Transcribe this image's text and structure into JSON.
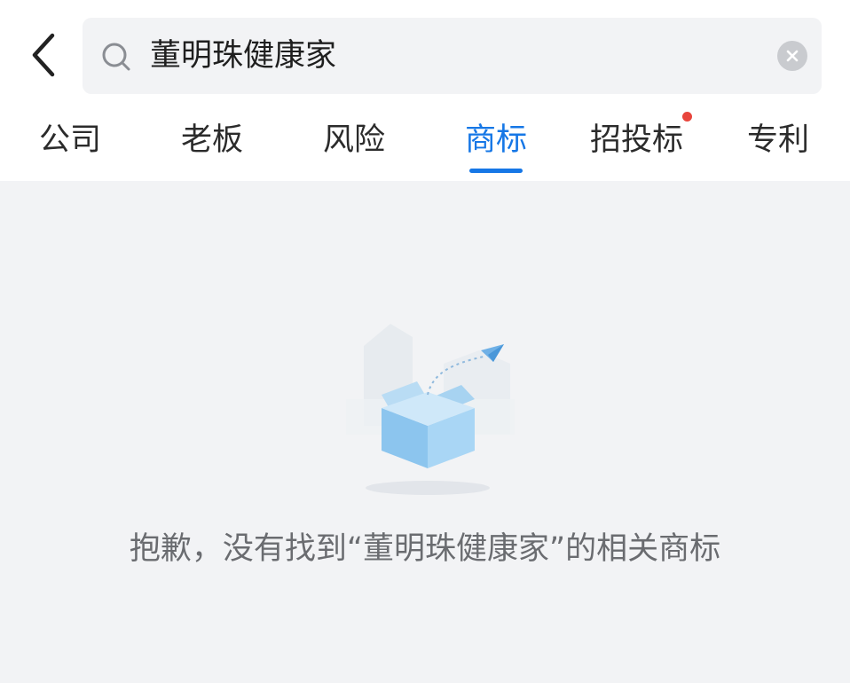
{
  "search": {
    "query": "董明珠健康家"
  },
  "tabs": [
    {
      "label": "公司",
      "active": false,
      "badge": false
    },
    {
      "label": "老板",
      "active": false,
      "badge": false
    },
    {
      "label": "风险",
      "active": false,
      "badge": false
    },
    {
      "label": "商标",
      "active": true,
      "badge": false
    },
    {
      "label": "招投标",
      "active": false,
      "badge": true
    },
    {
      "label": "专利",
      "active": false,
      "badge": false
    }
  ],
  "empty_state": {
    "message": "抱歉，没有找到“董明珠健康家”的相关商标"
  },
  "colors": {
    "accent": "#1677e6",
    "badge": "#e8453c",
    "background": "#f2f3f5",
    "text": "#2b2b2b",
    "muted_text": "#6a6c70"
  },
  "icons": {
    "back": "chevron-left-icon",
    "search": "search-icon",
    "clear": "clear-circle-icon",
    "empty": "empty-box-icon"
  }
}
